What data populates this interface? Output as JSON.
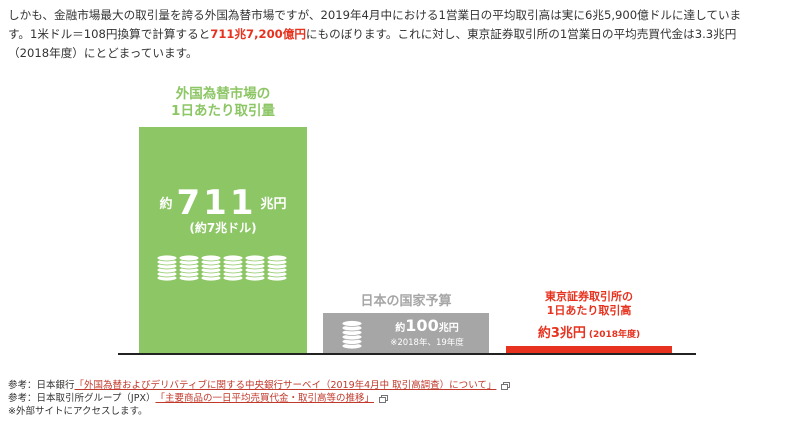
{
  "intro": {
    "line1": "しかも、金融市場最大の取引量を誇る外国為替市場ですが、2019年4月中における1営業日の平均取引高は実に6兆5,900億ドルに達していま",
    "line2_pre": "す。1米ドル＝108円換算で計算すると",
    "line2_highlight": "711兆7,200億円",
    "line2_post": "にものぼります。これに対し、東京証券取引所の1営業日の平均売買代金は3.3兆円",
    "line3": "（2018年度）にとどまっています。"
  },
  "chart": {
    "fx": {
      "label_line1": "外国為替市場の",
      "label_line2": "1日あたり取引量",
      "prefix": "約",
      "value": "711",
      "unit": "兆円",
      "sub": "(約7兆ドル)"
    },
    "budget": {
      "label": "日本の国家予算",
      "prefix": "約",
      "value": "100",
      "unit": "兆円",
      "note": "※2018年、19年度"
    },
    "tse": {
      "label_line1": "東京証券取引所の",
      "label_line2": "1日あたり取引高",
      "value_text": "約3兆円",
      "note": "(2018年度)"
    },
    "colors": {
      "fx": "#8cc665",
      "budget": "#a6a6a6",
      "tse": "#e6321e"
    }
  },
  "chart_data": {
    "type": "bar",
    "categories": [
      "外国為替市場の1日あたり取引量",
      "日本の国家予算",
      "東京証券取引所の1日あたり取引高"
    ],
    "values": [
      711,
      100,
      3.3
    ],
    "ylim": [
      0,
      711
    ]
  },
  "references": {
    "ref1_prefix": "参考：日本銀行",
    "ref1_link": "「外国為替およびデリバティブに関する中央銀行サーベイ（2019年4月中 取引高調査）について」",
    "ref2_prefix": "参考：日本取引所グループ（JPX）",
    "ref2_link": "「主要商品の一日平均売買代金・取引高等の推移」",
    "external_note": "※外部サイトにアクセスします。"
  }
}
